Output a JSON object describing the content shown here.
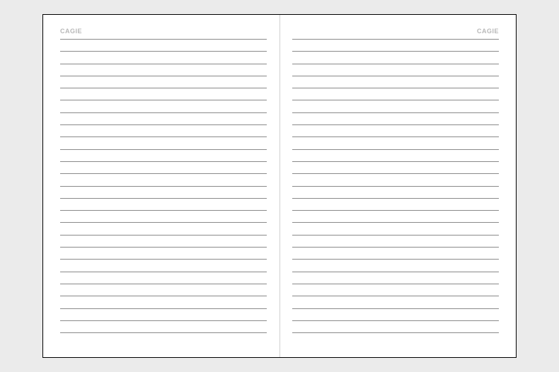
{
  "notebook": {
    "leftPage": {
      "brand": "CAGIE",
      "lineCount": 25
    },
    "rightPage": {
      "brand": "CAGIE",
      "lineCount": 25
    }
  }
}
